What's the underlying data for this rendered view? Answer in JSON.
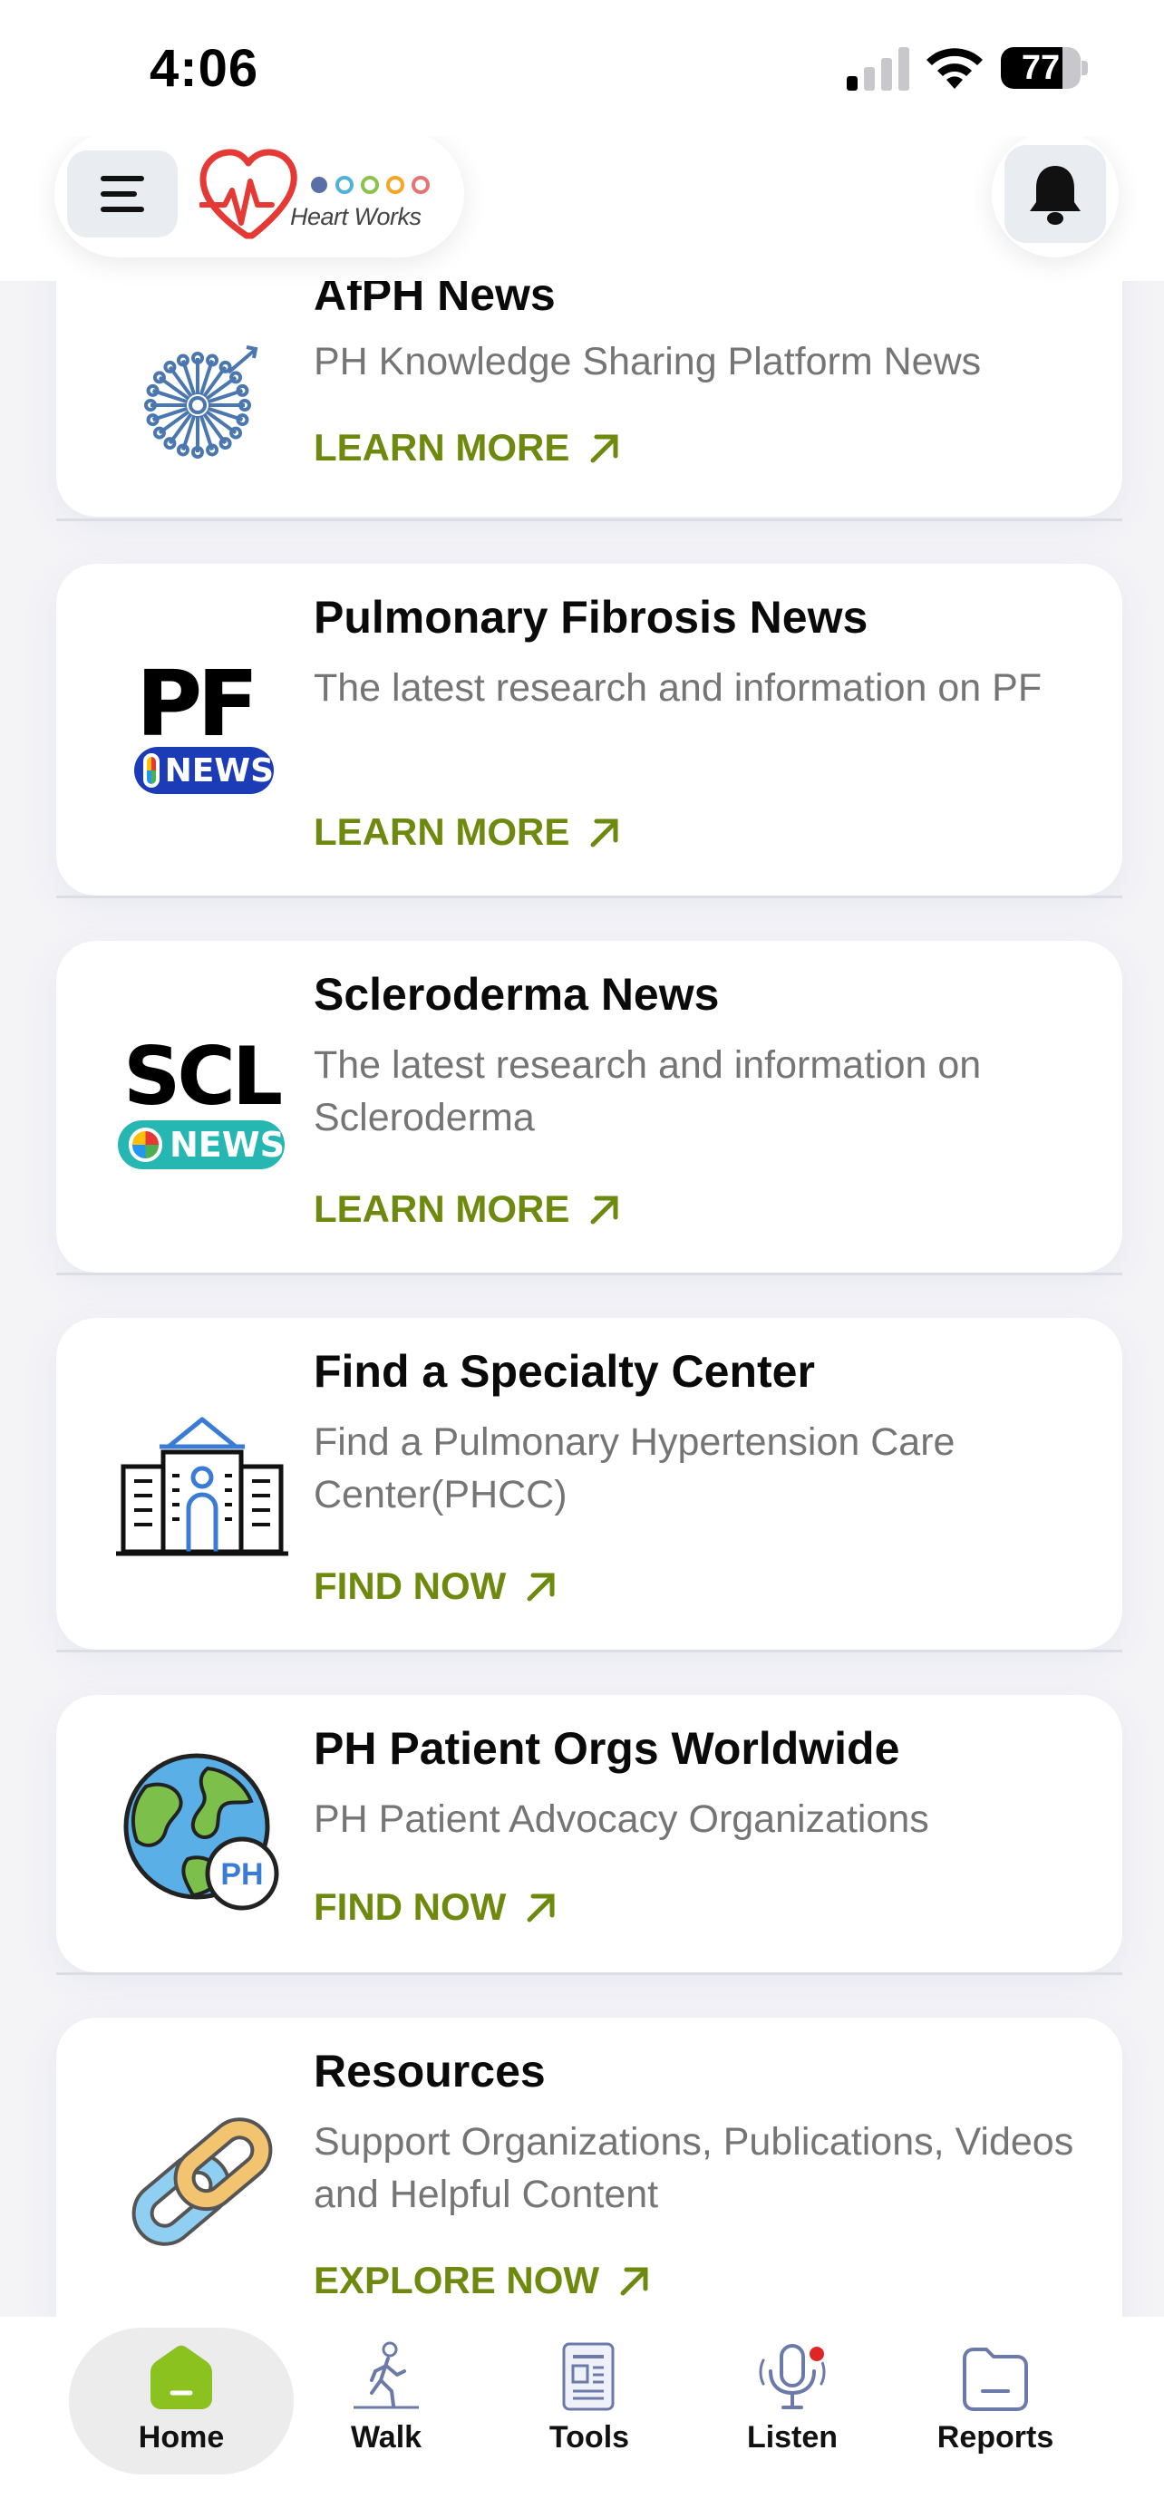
{
  "status_bar": {
    "time": "4:06",
    "battery_percent": "77",
    "battery_level": 0.77,
    "signal_bars_active": 1
  },
  "header": {
    "logo_text": "Heart Works",
    "logo_dot_colors": [
      "#5a6fa8",
      "#4fb3d9",
      "#8bc34a",
      "#f5a623",
      "#e57373"
    ],
    "menu_icon": "hamburger-menu-icon",
    "bell_icon": "bell-icon"
  },
  "cards": [
    {
      "title": "AfPH News",
      "description": "PH Knowledge Sharing Platform News",
      "cta": "LEARN MORE",
      "icon": "afph-dandelion-logo"
    },
    {
      "title": "Pulmonary Fibrosis News",
      "description": "The latest research and information on PF",
      "cta": "LEARN MORE",
      "icon": "pf-news-logo",
      "logo_big": "PF",
      "logo_badge": "NEWS"
    },
    {
      "title": "Scleroderma News",
      "description": "The latest research and information on Scleroderma",
      "cta": "LEARN MORE",
      "icon": "scl-news-logo",
      "logo_big": "SCL",
      "logo_badge": "NEWS"
    },
    {
      "title": "Find a Specialty Center",
      "description": "Find a Pulmonary Hypertension Care Center(PHCC)",
      "cta": "FIND NOW",
      "icon": "hospital-building-icon"
    },
    {
      "title": "PH Patient Orgs Worldwide",
      "description": "PH Patient Advocacy Organizations",
      "cta": "FIND NOW",
      "icon": "globe-ph-icon",
      "icon_badge": "PH"
    },
    {
      "title": "Resources",
      "description": "Support Organizations, Publications, Videos and Helpful Content",
      "cta": "EXPLORE NOW",
      "icon": "chain-link-icon"
    }
  ],
  "tabbar": {
    "tabs": [
      {
        "label": "Home",
        "icon": "home-icon",
        "active": true
      },
      {
        "label": "Walk",
        "icon": "walk-icon",
        "active": false
      },
      {
        "label": "Tools",
        "icon": "tools-document-icon",
        "active": false
      },
      {
        "label": "Listen",
        "icon": "microphone-icon",
        "active": false,
        "notification": true
      },
      {
        "label": "Reports",
        "icon": "reports-folder-icon",
        "active": false
      }
    ]
  },
  "colors": {
    "accent_green": "#6e8a0e",
    "home_green": "#8bc21f",
    "heart_red": "#e53935",
    "notification_red": "#e02525",
    "background": "#f4f4f7"
  }
}
